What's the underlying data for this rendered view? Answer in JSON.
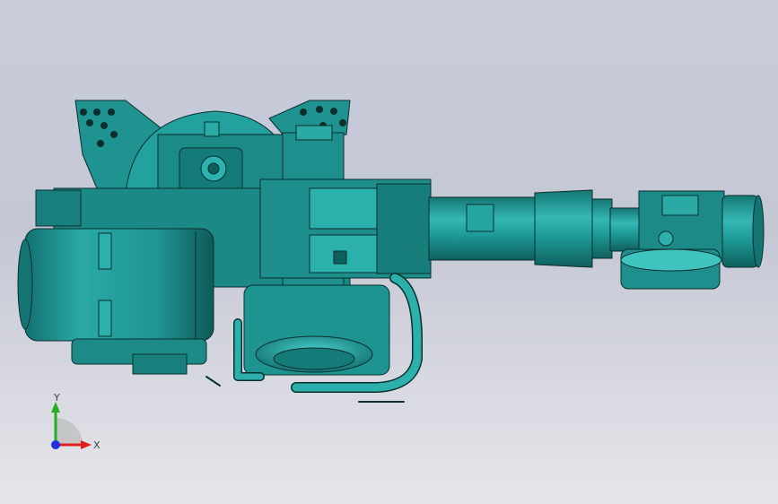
{
  "viewport": {
    "background_top": "#c9ccdb",
    "background_bottom": "#e6e6ea"
  },
  "model": {
    "name": "robot-arm-assembly",
    "body_color": "#1e8f8d",
    "highlight_color": "#3fc4c0",
    "edge_color": "#0b2f2e"
  },
  "triad": {
    "x_label": "X",
    "y_label": "Y",
    "x_color": "#e02020",
    "y_color": "#20b020",
    "z_color": "#2030e0"
  }
}
